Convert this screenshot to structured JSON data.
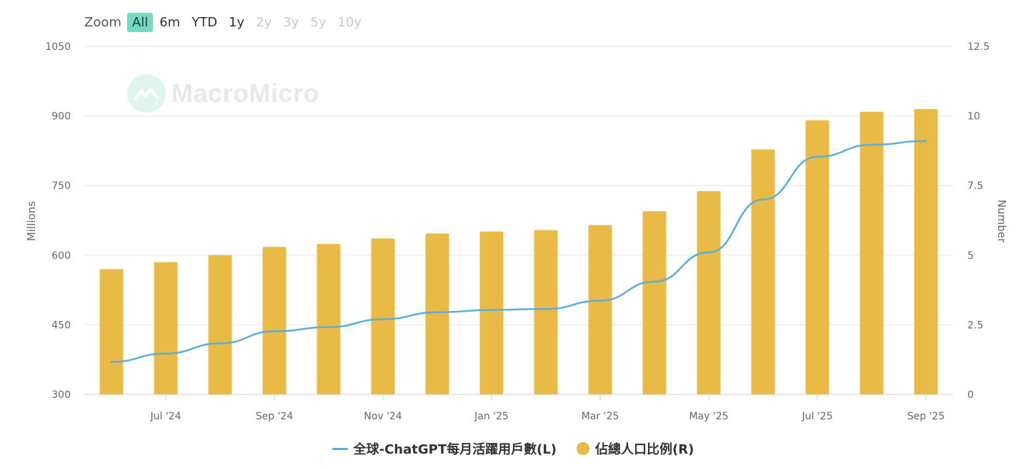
{
  "zoom": {
    "label": "Zoom",
    "buttons": [
      {
        "label": "All",
        "state": "active"
      },
      {
        "label": "6m",
        "state": "normal"
      },
      {
        "label": "YTD",
        "state": "normal"
      },
      {
        "label": "1y",
        "state": "normal"
      },
      {
        "label": "2y",
        "state": "disabled"
      },
      {
        "label": "3y",
        "state": "disabled"
      },
      {
        "label": "5y",
        "state": "disabled"
      },
      {
        "label": "10y",
        "state": "disabled"
      }
    ]
  },
  "watermark": {
    "text": "MacroMicro"
  },
  "chart_data": {
    "type": "bar+line",
    "title": "",
    "x": [
      "2024-06",
      "2024-07",
      "2024-08",
      "2024-09",
      "2024-10",
      "2024-11",
      "2024-12",
      "2025-01",
      "2025-02",
      "2025-03",
      "2025-04",
      "2025-05",
      "2025-06",
      "2025-07",
      "2025-08",
      "2025-09"
    ],
    "x_tick_labels": [
      {
        "label": "Jul '24",
        "index": 1
      },
      {
        "label": "Sep '24",
        "index": 3
      },
      {
        "label": "Nov '24",
        "index": 5
      },
      {
        "label": "Jan '25",
        "index": 7
      },
      {
        "label": "Mar '25",
        "index": 9
      },
      {
        "label": "May '25",
        "index": 11
      },
      {
        "label": "Jul '25",
        "index": 13
      },
      {
        "label": "Sep '25",
        "index": 15
      }
    ],
    "left_axis": {
      "label": "Millions",
      "ylim": [
        300,
        1050
      ],
      "ticks": [
        "300",
        "450",
        "600",
        "750",
        "900",
        "1050"
      ]
    },
    "right_axis": {
      "label": "Number",
      "ylim": [
        0,
        12.5
      ],
      "ticks": [
        "0",
        "2.5",
        "5",
        "7.5",
        "10",
        "12.5"
      ]
    },
    "grid": true,
    "legend_position": "bottom-center",
    "series": [
      {
        "name": "全球-ChatGPT每月活躍用戶數(L)",
        "type": "line",
        "axis": "left",
        "color": "#5aaed8",
        "values": [
          370,
          388,
          410,
          436,
          445,
          462,
          477,
          482,
          484,
          502,
          543,
          606,
          720,
          812,
          838,
          846
        ]
      },
      {
        "name": "佔總人口比例(R)",
        "type": "bar",
        "axis": "right",
        "color": "#e9ba45",
        "values": [
          4.5,
          4.75,
          5.0,
          5.3,
          5.4,
          5.6,
          5.78,
          5.85,
          5.9,
          6.08,
          6.58,
          7.3,
          8.8,
          9.85,
          10.15,
          10.25
        ]
      }
    ]
  }
}
